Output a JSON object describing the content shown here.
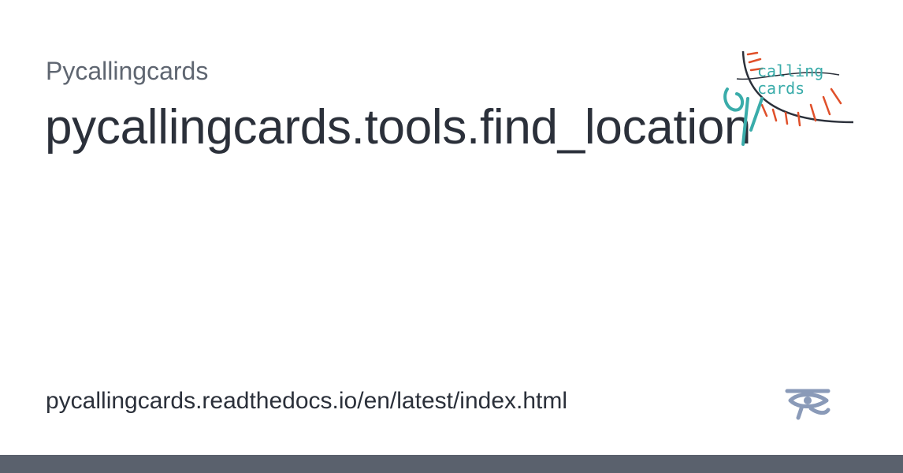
{
  "site": {
    "name": "Pycallingcards"
  },
  "page": {
    "title": "pycallingcards.tools.find_location"
  },
  "footer": {
    "url": "pycallingcards.readthedocs.io/en/latest/index.html"
  },
  "logo": {
    "line1": "calling",
    "line2": "cards",
    "icon": "pycallingcards-logo"
  },
  "branding": {
    "icon": "readthedocs-eye-icon"
  },
  "colors": {
    "title": "#2b303a",
    "subtitle": "#5f6671",
    "bar": "#5a616d",
    "logo_teal": "#3aacaa",
    "logo_red": "#e0502a",
    "rtd_blue": "#8a9ab8"
  }
}
